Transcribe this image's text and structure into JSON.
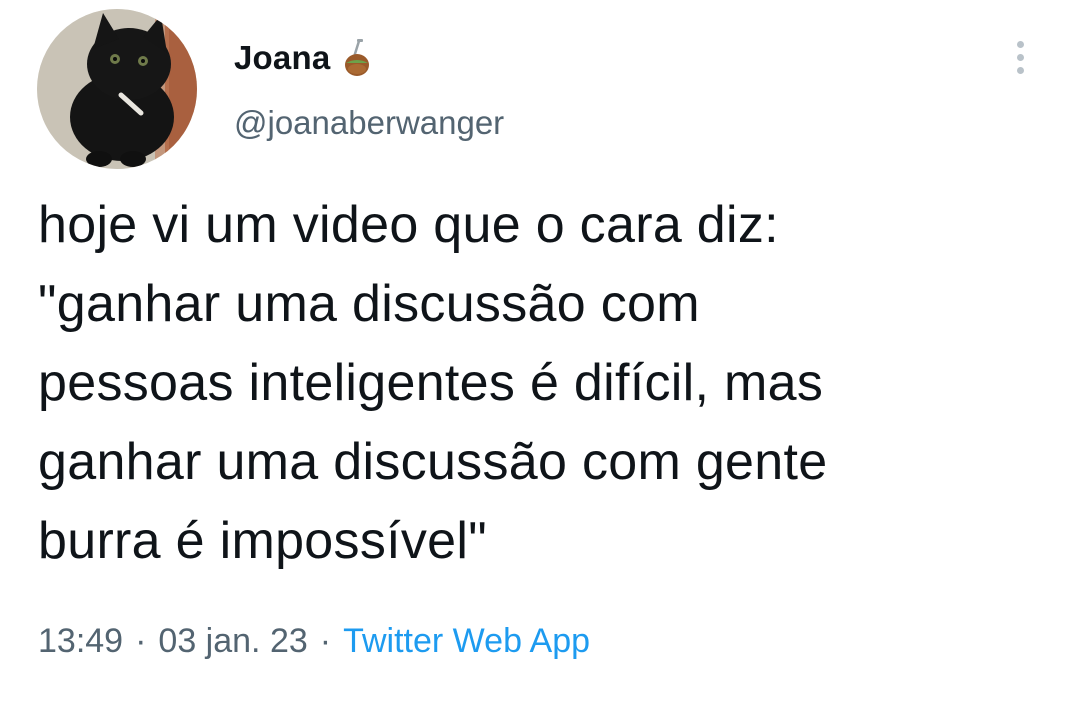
{
  "tweet": {
    "author": {
      "display_name": "Joana",
      "name_emoji_icon": "mate-gourd-icon",
      "handle": "@joanaberwanger",
      "avatar_icon": "black-cat-photo"
    },
    "text": "hoje vi um video que o cara diz:\n\"ganhar uma discussão com\npessoas inteligentes é difícil, mas\nganhar uma discussão com gente\nburra é impossível\"",
    "time": "13:49",
    "separator": "·",
    "date": "03 jan. 23",
    "source": "Twitter Web App",
    "more_icon": "more-options-icon"
  },
  "colors": {
    "text_primary": "#0f1419",
    "text_secondary": "#536471",
    "link": "#1d9bf0",
    "background": "#ffffff"
  }
}
